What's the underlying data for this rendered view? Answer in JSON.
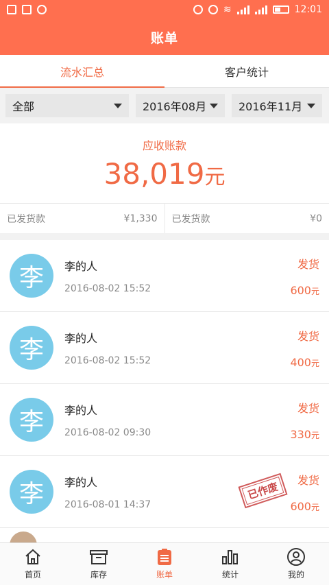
{
  "statusbar": {
    "time": "12:01"
  },
  "header": {
    "title": "账单"
  },
  "tabs": [
    {
      "label": "流水汇总"
    },
    {
      "label": "客户统计"
    }
  ],
  "filters": {
    "category": "全部",
    "start_month": "2016年08月",
    "end_month": "2016年11月"
  },
  "summary": {
    "label": "应收账款",
    "amount": "38,019",
    "unit": "元"
  },
  "subtotals": [
    {
      "label": "已发货款",
      "value": "¥1,330"
    },
    {
      "label": "已发货款",
      "value": "¥0"
    }
  ],
  "records": [
    {
      "avatar": "李",
      "name": "李的人",
      "time": "2016-08-02 15:52",
      "type": "发货",
      "amount": "600",
      "unit": "元"
    },
    {
      "avatar": "李",
      "name": "李的人",
      "time": "2016-08-02 15:52",
      "type": "发货",
      "amount": "400",
      "unit": "元"
    },
    {
      "avatar": "李",
      "name": "李的人",
      "time": "2016-08-02 09:30",
      "type": "发货",
      "amount": "330",
      "unit": "元"
    },
    {
      "avatar": "李",
      "name": "李的人",
      "time": "2016-08-01 14:37",
      "type": "发货",
      "amount": "600",
      "unit": "元",
      "stamp": "已作废"
    }
  ],
  "bottomnav": [
    {
      "label": "首页",
      "icon": "home-icon"
    },
    {
      "label": "库存",
      "icon": "box-icon"
    },
    {
      "label": "账单",
      "icon": "bill-icon"
    },
    {
      "label": "统计",
      "icon": "chart-icon"
    },
    {
      "label": "我的",
      "icon": "user-icon"
    }
  ],
  "colors": {
    "primary": "#ff6f4f",
    "accent": "#f06a45",
    "avatar": "#79cbe9"
  }
}
